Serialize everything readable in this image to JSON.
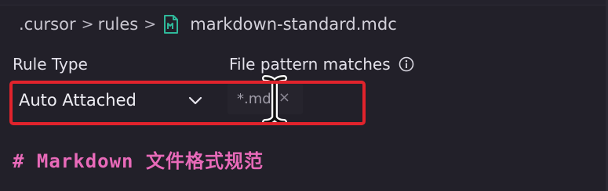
{
  "breadcrumb": {
    "items": [
      ".cursor",
      "rules"
    ],
    "separator": ">",
    "file_icon": "markdown-file-icon",
    "file_name": "markdown-standard.mdc"
  },
  "form": {
    "rule_type_label": "Rule Type",
    "rule_type_value": "Auto Attached",
    "file_pattern_label": "File pattern matches",
    "file_pattern_value": "*.md",
    "clear_glyph": "×"
  },
  "editor": {
    "heading_text": "# Markdown 文件格式规范"
  },
  "colors": {
    "background": "#222029",
    "highlight": "#e1232c",
    "heading": "#e86ab9",
    "file_icon": "#2fb89a"
  }
}
